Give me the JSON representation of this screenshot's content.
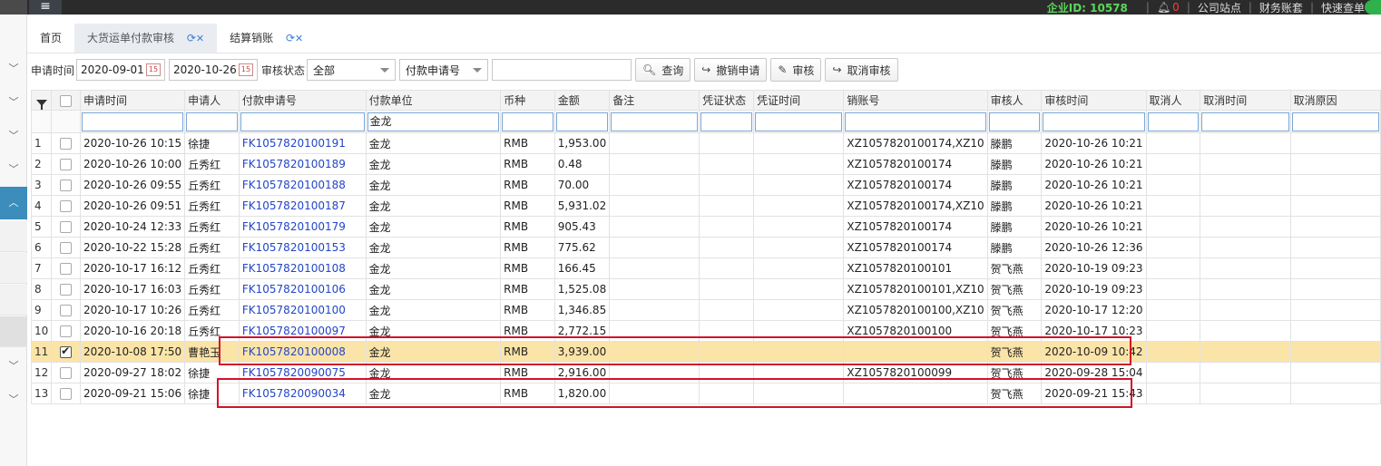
{
  "topbar": {
    "menu_icon": "menu-icon",
    "corp_label": "企业ID: 10578",
    "notify_count": "0",
    "links": [
      "公司站点",
      "财务账套",
      "快速查单"
    ]
  },
  "tabs": [
    {
      "label": "首页"
    },
    {
      "label": "大货运单付款审核"
    },
    {
      "label": "结算销账"
    }
  ],
  "filters": {
    "date_label": "申请时间",
    "date_from": "2020-09-01",
    "date_to": "2020-10-26",
    "status_label": "审核状态",
    "status_value": "全部",
    "field_select": "付款申请号",
    "search_value": ""
  },
  "buttons": {
    "query": "查询",
    "revoke": "撤销申请",
    "audit": "审核",
    "cancel_audit": "取消审核"
  },
  "columns": [
    "申请时间",
    "申请人",
    "付款申请号",
    "付款单位",
    "币种",
    "金额",
    "备注",
    "凭证状态",
    "凭证时间",
    "销账号",
    "审核人",
    "审核时间",
    "取消人",
    "取消时间",
    "取消原因"
  ],
  "column_filters": {
    "payer": "金龙"
  },
  "rows": [
    {
      "no": "1",
      "time": "2020-10-26 10:15",
      "applicant": "徐捷",
      "apply_no": "FK1057820100191",
      "payer": "金龙",
      "currency": "RMB",
      "amount": "1,953.00",
      "writeoff": "XZ1057820100174,XZ10",
      "auditor": "滕鹏",
      "audit_time": "2020-10-26 10:21",
      "checked": false
    },
    {
      "no": "2",
      "time": "2020-10-26 10:00",
      "applicant": "丘秀红",
      "apply_no": "FK1057820100189",
      "payer": "金龙",
      "currency": "RMB",
      "amount": "0.48",
      "writeoff": "XZ1057820100174",
      "auditor": "滕鹏",
      "audit_time": "2020-10-26 10:21",
      "checked": false
    },
    {
      "no": "3",
      "time": "2020-10-26 09:55",
      "applicant": "丘秀红",
      "apply_no": "FK1057820100188",
      "payer": "金龙",
      "currency": "RMB",
      "amount": "70.00",
      "writeoff": "XZ1057820100174",
      "auditor": "滕鹏",
      "audit_time": "2020-10-26 10:21",
      "checked": false
    },
    {
      "no": "4",
      "time": "2020-10-26 09:51",
      "applicant": "丘秀红",
      "apply_no": "FK1057820100187",
      "payer": "金龙",
      "currency": "RMB",
      "amount": "5,931.02",
      "writeoff": "XZ1057820100174,XZ10",
      "auditor": "滕鹏",
      "audit_time": "2020-10-26 10:21",
      "checked": false
    },
    {
      "no": "5",
      "time": "2020-10-24 12:33",
      "applicant": "丘秀红",
      "apply_no": "FK1057820100179",
      "payer": "金龙",
      "currency": "RMB",
      "amount": "905.43",
      "writeoff": "XZ1057820100174",
      "auditor": "滕鹏",
      "audit_time": "2020-10-26 10:21",
      "checked": false
    },
    {
      "no": "6",
      "time": "2020-10-22 15:28",
      "applicant": "丘秀红",
      "apply_no": "FK1057820100153",
      "payer": "金龙",
      "currency": "RMB",
      "amount": "775.62",
      "writeoff": "XZ1057820100174",
      "auditor": "滕鹏",
      "audit_time": "2020-10-26 12:36",
      "checked": false
    },
    {
      "no": "7",
      "time": "2020-10-17 16:12",
      "applicant": "丘秀红",
      "apply_no": "FK1057820100108",
      "payer": "金龙",
      "currency": "RMB",
      "amount": "166.45",
      "writeoff": "XZ1057820100101",
      "auditor": "贺飞燕",
      "audit_time": "2020-10-19 09:23",
      "checked": false
    },
    {
      "no": "8",
      "time": "2020-10-17 16:03",
      "applicant": "丘秀红",
      "apply_no": "FK1057820100106",
      "payer": "金龙",
      "currency": "RMB",
      "amount": "1,525.08",
      "writeoff": "XZ1057820100101,XZ10",
      "auditor": "贺飞燕",
      "audit_time": "2020-10-19 09:23",
      "checked": false
    },
    {
      "no": "9",
      "time": "2020-10-17 10:26",
      "applicant": "丘秀红",
      "apply_no": "FK1057820100100",
      "payer": "金龙",
      "currency": "RMB",
      "amount": "1,346.85",
      "writeoff": "XZ1057820100100,XZ10",
      "auditor": "贺飞燕",
      "audit_time": "2020-10-17 12:20",
      "checked": false
    },
    {
      "no": "10",
      "time": "2020-10-16 20:18",
      "applicant": "丘秀红",
      "apply_no": "FK1057820100097",
      "payer": "金龙",
      "currency": "RMB",
      "amount": "2,772.15",
      "writeoff": "XZ1057820100100",
      "auditor": "贺飞燕",
      "audit_time": "2020-10-17 10:23",
      "checked": false
    },
    {
      "no": "11",
      "time": "2020-10-08 17:50",
      "applicant": "曹艳玉",
      "apply_no": "FK1057820100008",
      "payer": "金龙",
      "currency": "RMB",
      "amount": "3,939.00",
      "writeoff": "",
      "auditor": "贺飞燕",
      "audit_time": "2020-10-09 10:42",
      "checked": true
    },
    {
      "no": "12",
      "time": "2020-09-27 18:02",
      "applicant": "徐捷",
      "apply_no": "FK1057820090075",
      "payer": "金龙",
      "currency": "RMB",
      "amount": "2,916.00",
      "writeoff": "XZ1057820100099",
      "auditor": "贺飞燕",
      "audit_time": "2020-09-28 15:04",
      "checked": false
    },
    {
      "no": "13",
      "time": "2020-09-21 15:06",
      "applicant": "徐捷",
      "apply_no": "FK1057820090034",
      "payer": "金龙",
      "currency": "RMB",
      "amount": "1,820.00",
      "writeoff": "",
      "auditor": "贺飞燕",
      "audit_time": "2020-09-21 15:43",
      "checked": false
    }
  ]
}
